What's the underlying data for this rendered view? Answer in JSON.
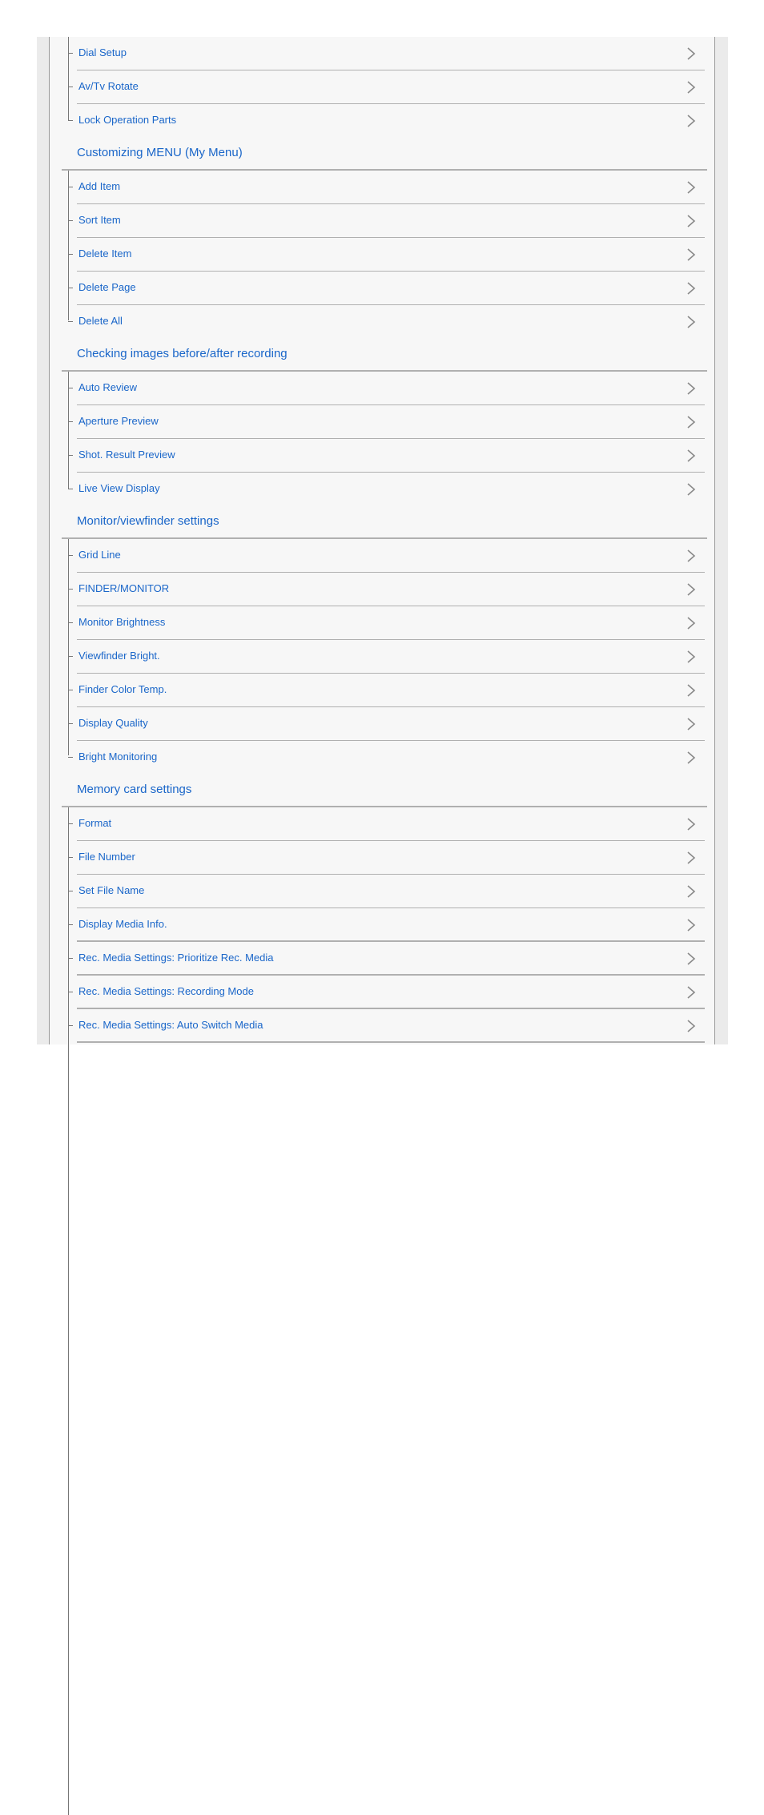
{
  "colors": {
    "link": "#1a66c9",
    "divider": "#b0b0b0",
    "panel": "#f7f7f7",
    "frame": "#ebebeb"
  },
  "groups": [
    {
      "title": "",
      "items": [
        "Dial Setup",
        "Av/Tv Rotate",
        "Lock Operation Parts"
      ]
    },
    {
      "title": "Customizing MENU (My Menu)",
      "items": [
        "Add Item",
        "Sort Item",
        "Delete Item",
        "Delete Page",
        "Delete All"
      ]
    },
    {
      "title": "Checking images before/after recording",
      "items": [
        "Auto Review",
        "Aperture Preview",
        "Shot. Result Preview",
        "Live View Display"
      ]
    },
    {
      "title": "Monitor/viewfinder settings",
      "items": [
        "Grid Line",
        "FINDER/MONITOR",
        "Monitor Brightness",
        "Viewfinder Bright.",
        "Finder Color Temp.",
        "Display Quality",
        "Bright Monitoring"
      ]
    },
    {
      "title": "Memory card settings",
      "items": [
        "Format",
        "File Number",
        "Set File Name",
        "Display Media Info.",
        "Rec. Media Settings: Prioritize Rec. Media",
        "Rec. Media Settings: Recording Mode",
        "Rec. Media Settings: Auto Switch Media"
      ]
    }
  ],
  "icons": {
    "row_arrow": "chevron-right-icon"
  }
}
